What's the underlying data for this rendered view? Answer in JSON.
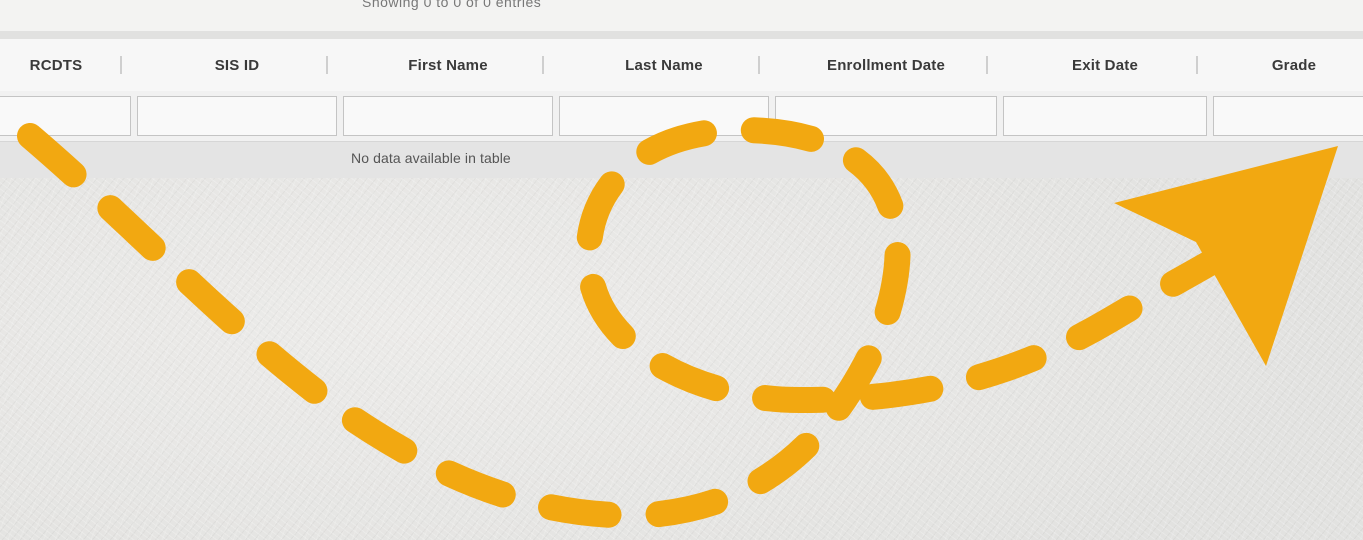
{
  "table": {
    "info": "Showing 0 to 0 of 0 entries",
    "columns": [
      "RCDTS",
      "SIS ID",
      "First Name",
      "Last Name",
      "Enrollment Date",
      "Exit Date",
      "Grade"
    ],
    "empty_message": "No data available in table"
  },
  "overlay": {
    "arrow_color": "#F2A811",
    "arrow_style": "dashed-loop",
    "arrow_icon": "arrow-head-icon"
  }
}
